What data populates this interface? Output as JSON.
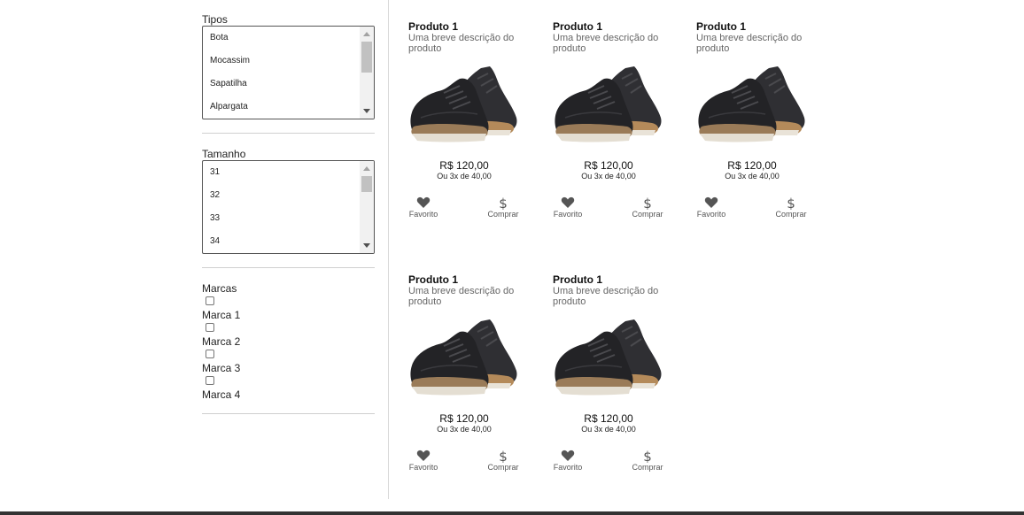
{
  "filters": {
    "types": {
      "label": "Tipos",
      "options": [
        "Bota",
        "Mocassim",
        "Sapatilha",
        "Alpargata"
      ]
    },
    "sizes": {
      "label": "Tamanho",
      "options": [
        "31",
        "32",
        "33",
        "34"
      ]
    },
    "brands": {
      "label": "Marcas",
      "items": [
        "Marca 1",
        "Marca 2",
        "Marca 3",
        "Marca 4"
      ]
    }
  },
  "products": [
    {
      "title": "Produto 1",
      "description": "Uma breve descrição do produto",
      "price": "R$ 120,00",
      "installments": "Ou 3x de 40,00",
      "favorite_label": "Favorito",
      "buy_label": "Comprar"
    },
    {
      "title": "Produto 1",
      "description": "Uma breve descrição do produto",
      "price": "R$ 120,00",
      "installments": "Ou 3x de 40,00",
      "favorite_label": "Favorito",
      "buy_label": "Comprar"
    },
    {
      "title": "Produto 1",
      "description": "Uma breve descrição do produto",
      "price": "R$ 120,00",
      "installments": "Ou 3x de 40,00",
      "favorite_label": "Favorito",
      "buy_label": "Comprar"
    },
    {
      "title": "Produto 1",
      "description": "Uma breve descrição do produto",
      "price": "R$ 120,00",
      "installments": "Ou 3x de 40,00",
      "favorite_label": "Favorito",
      "buy_label": "Comprar"
    },
    {
      "title": "Produto 1",
      "description": "Uma breve descrição do produto",
      "price": "R$ 120,00",
      "installments": "Ou 3x de 40,00",
      "favorite_label": "Favorito",
      "buy_label": "Comprar"
    }
  ]
}
